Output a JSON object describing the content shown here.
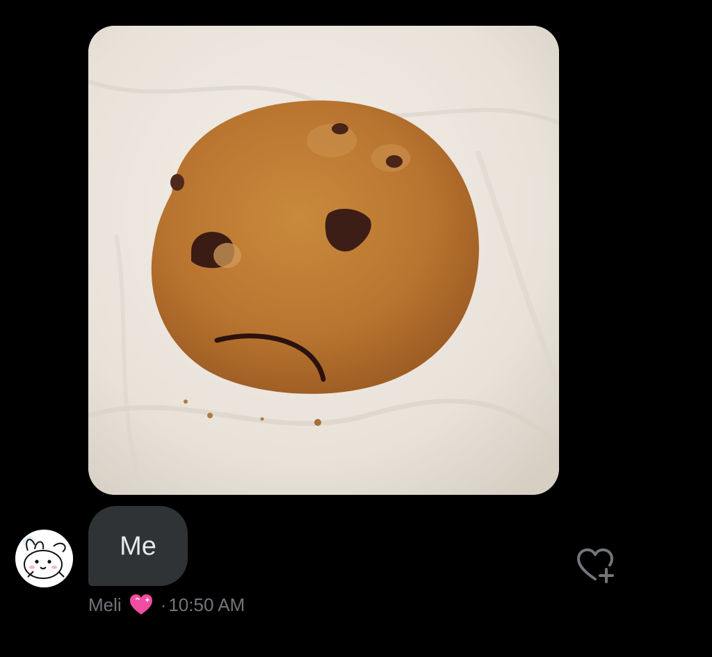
{
  "message": {
    "image_icon": "sad-chocolate-chip-cookie-photo",
    "text": "Me",
    "sender_name": "Meli",
    "name_emoji_icon": "sparkling-pink-heart-icon",
    "separator": "·",
    "time": "10:50 AM"
  },
  "avatar": {
    "icon": "white-bunny-avatar"
  },
  "actions": {
    "react_icon": "add-reaction-heart-icon"
  },
  "colors": {
    "background": "#000000",
    "bubble": "#2f3336",
    "bubble_text": "#e7e9ea",
    "meta_text": "#71767b",
    "heart": "#f04ea0"
  }
}
